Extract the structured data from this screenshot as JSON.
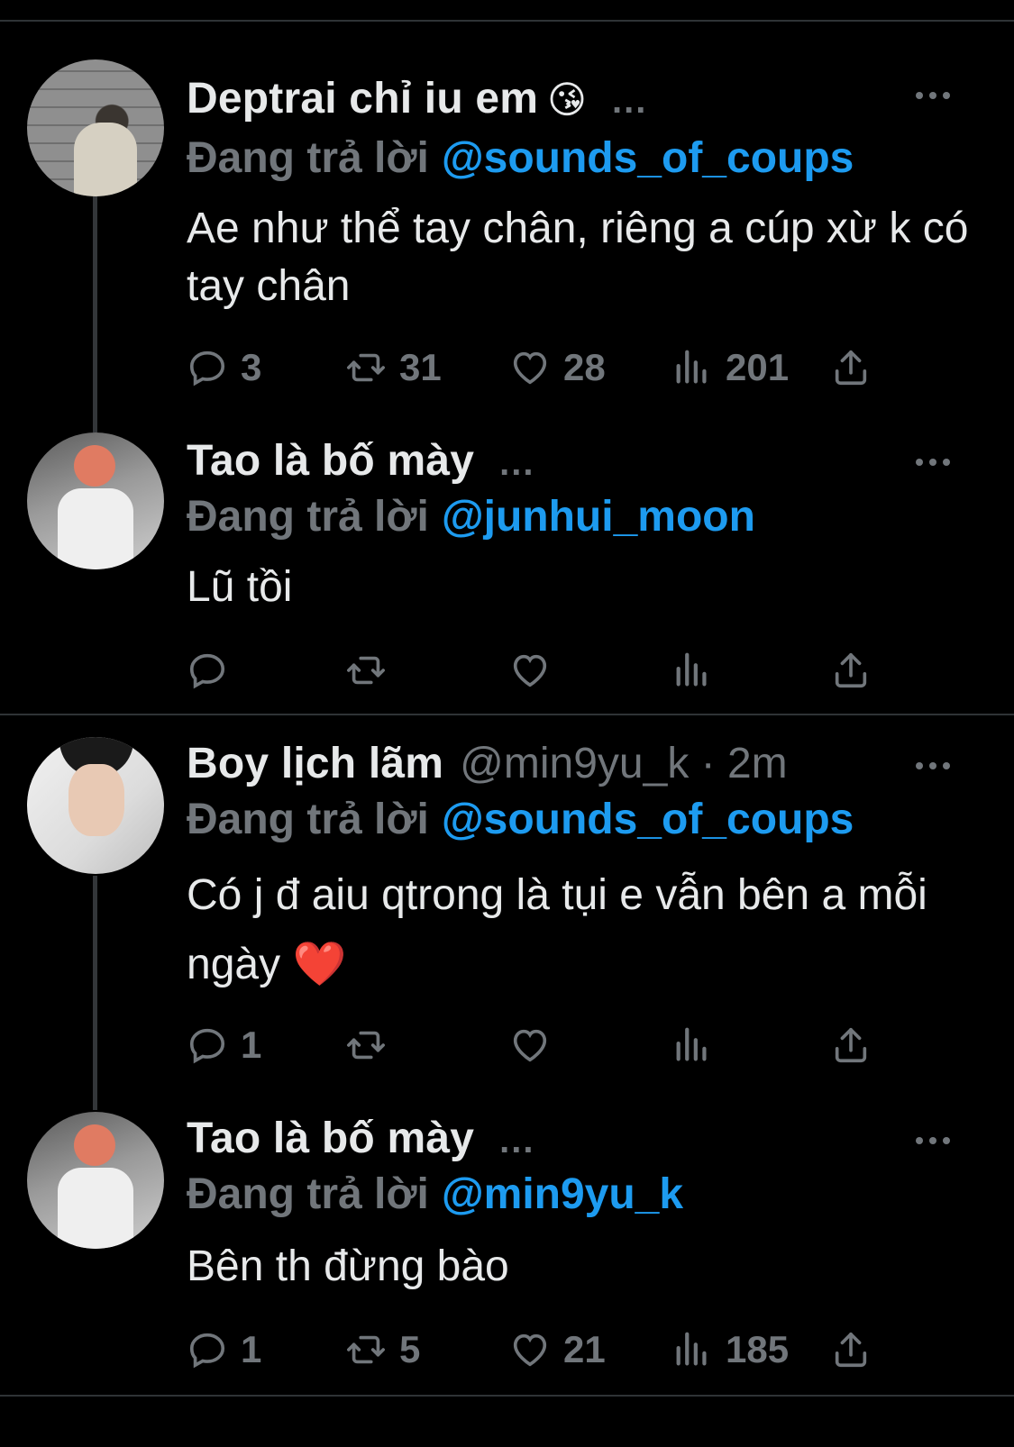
{
  "tweets": [
    {
      "name": "Deptrai chỉ iu em",
      "emoji": "😘",
      "truncation": "...",
      "handle_time": "",
      "reply_label": "Đang trả lời",
      "reply_mention": "@sounds_of_coups",
      "text": "Ae như thể tay chân, riêng a cúp xừ k có tay chân",
      "emoji_end": "",
      "counts": {
        "replies": "3",
        "retweets": "31",
        "likes": "28",
        "views": "201"
      }
    },
    {
      "name": "Tao là bố mày",
      "emoji": "",
      "truncation": "...",
      "handle_time": "",
      "reply_label": "Đang trả lời",
      "reply_mention": "@junhui_moon",
      "text": "Lũ tồi",
      "emoji_end": "",
      "counts": {
        "replies": "",
        "retweets": "",
        "likes": "",
        "views": ""
      }
    },
    {
      "name": "Boy lịch lãm",
      "emoji": "",
      "truncation": "",
      "handle_time": "@min9yu_k · 2m",
      "reply_label": "Đang trả lời",
      "reply_mention": "@sounds_of_coups",
      "text": "Có j đ aiu qtrong là tụi e vẫn bên a mỗi ngày",
      "emoji_end": "❤️",
      "counts": {
        "replies": "1",
        "retweets": "",
        "likes": "",
        "views": ""
      }
    },
    {
      "name": "Tao là bố mày",
      "emoji": "",
      "truncation": "...",
      "handle_time": "",
      "reply_label": "Đang trả lời",
      "reply_mention": "@min9yu_k",
      "text": "Bên th đừng bào",
      "emoji_end": "",
      "counts": {
        "replies": "1",
        "retweets": "5",
        "likes": "21",
        "views": "185"
      }
    }
  ],
  "icons": {
    "reply": "reply-icon",
    "retweet": "retweet-icon",
    "like": "heart-icon",
    "views": "views-icon",
    "share": "share-icon",
    "more": "more-icon"
  },
  "colors": {
    "background": "#000000",
    "text": "#e7e9ea",
    "muted": "#71767b",
    "mention": "#1d9bf0",
    "heart_emoji": "#f91880"
  }
}
